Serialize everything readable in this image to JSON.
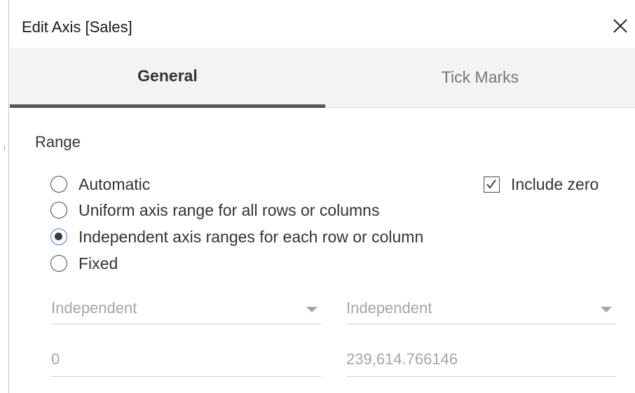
{
  "dialog": {
    "title": "Edit Axis [Sales]",
    "close_icon": "close-icon"
  },
  "tabs": [
    {
      "label": "General",
      "selected": true
    },
    {
      "label": "Tick Marks",
      "selected": false
    }
  ],
  "range": {
    "label": "Range",
    "options": [
      {
        "label": "Automatic",
        "selected": false
      },
      {
        "label": "Uniform axis range for all rows or columns",
        "selected": false
      },
      {
        "label": "Independent axis ranges for each row or column",
        "selected": true
      },
      {
        "label": "Fixed",
        "selected": false
      }
    ],
    "include_zero": {
      "label": "Include zero",
      "checked": true
    },
    "start_select": {
      "value": "Independent",
      "icon": "chevron-down-icon"
    },
    "end_select": {
      "value": "Independent",
      "icon": "chevron-down-icon"
    },
    "start_value": "0",
    "end_value": "239,614.766146"
  },
  "colors": {
    "accent": "#3b7dc9",
    "tab_underline": "#555555",
    "tab_bar": "#f3f3f3",
    "disabled_text": "#a6a6a6"
  }
}
